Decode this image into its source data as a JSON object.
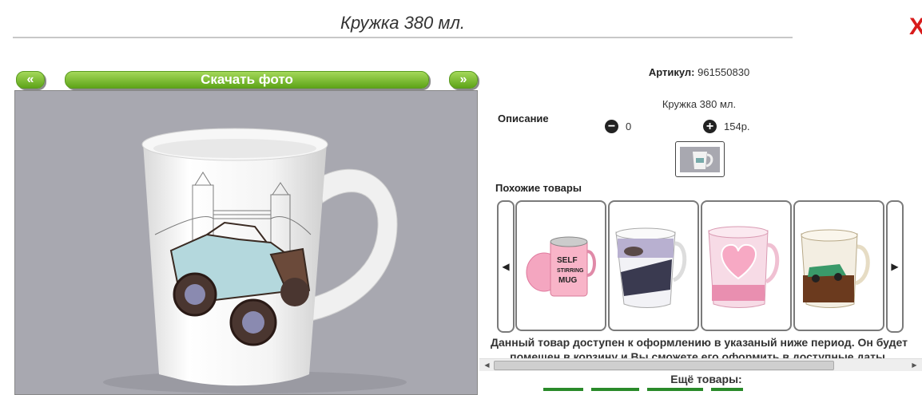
{
  "header": {
    "title": "Кружка 380 мл.",
    "close_label": "X"
  },
  "nav": {
    "prev_label": "«",
    "download_label": "Скачать фото",
    "next_label": "»"
  },
  "product": {
    "sku_label": "Артикул:",
    "sku_value": "961550830",
    "description_label": "Описание",
    "description_text": "Кружка 380 мл.",
    "quantity": "0",
    "price": "154р.",
    "minus_label": "−",
    "plus_label": "+"
  },
  "similar": {
    "title": "Похожие товары",
    "prev_icon": "◀",
    "next_icon": "▶",
    "items": [
      {
        "name": "self-stirring-mug",
        "text_lines": [
          "SELF",
          "STIRRING",
          "MUG"
        ]
      },
      {
        "name": "patterned-mug"
      },
      {
        "name": "heart-mug"
      },
      {
        "name": "car-mug"
      }
    ]
  },
  "notice": {
    "text": "Данный товар доступен к оформлению в указаный ниже период. Он будет помещен в корзину и Вы сможете его оформить в доступные даты."
  },
  "more": {
    "title": "Ещё товары:"
  },
  "colors": {
    "accent_green": "#6cb420",
    "close_red": "#d81c1c",
    "photo_bg": "#a8a8b0"
  }
}
